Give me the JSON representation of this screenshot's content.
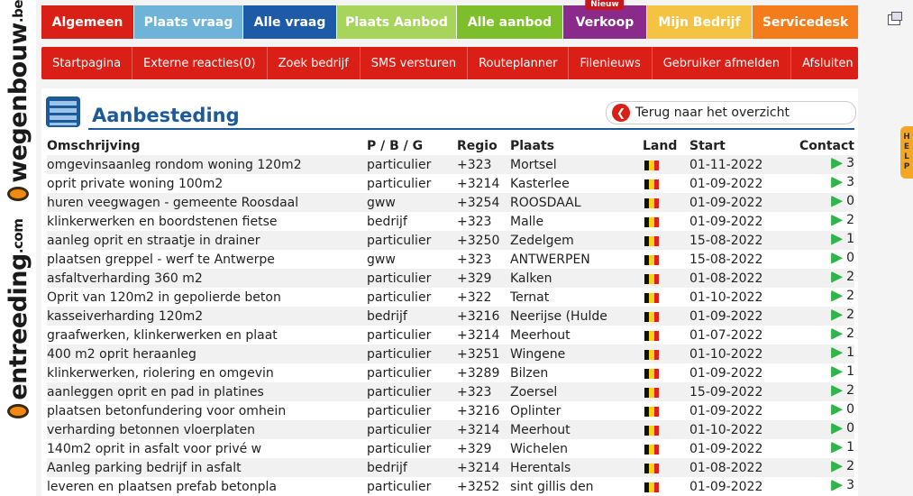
{
  "brand": {
    "text1": "entreeding",
    "text1_suffix": ".com",
    "text2": "wegenbouw",
    "text2_suffix": ".be",
    "accent": "#f28a12"
  },
  "topnav": [
    {
      "label": "Algemeen",
      "color": "#d91f16"
    },
    {
      "label": "Plaats vraag",
      "color": "#6fb3d9"
    },
    {
      "label": "Alle vraag",
      "color": "#1d5aa8"
    },
    {
      "label": "Plaats Aanbod",
      "color": "#a7d45a"
    },
    {
      "label": "Alle aanbod",
      "color": "#7cbf2a"
    },
    {
      "label": "Verkoop",
      "color": "#8a2a8a",
      "badge": "Nieuw"
    },
    {
      "label": "Mijn Bedrijf",
      "color": "#f5c343"
    },
    {
      "label": "Servicedesk",
      "color": "#f57c1a"
    }
  ],
  "subnav": [
    "Startpagina",
    "Externe reacties(0)",
    "Zoek bedrijf",
    "SMS versturen",
    "Routeplanner",
    "Filenieuws",
    "Gebruiker afmelden",
    "Afsluiten"
  ],
  "help": "HELP",
  "page": {
    "title": "Aanbesteding",
    "back_label": "Terug naar het overzicht"
  },
  "table": {
    "headers": [
      "Omschrijving",
      "P / B / G",
      "Regio",
      "Plaats",
      "Land",
      "Start",
      "Contact"
    ],
    "rows": [
      {
        "omschrijving": "omgevinsaanleg rondom woning 120m2",
        "pbg": "particulier",
        "regio": "+323",
        "plaats": "Mortsel",
        "start": "01-11-2022",
        "contact": "3"
      },
      {
        "omschrijving": "oprit private woning 100m2",
        "pbg": "particulier",
        "regio": "+3214",
        "plaats": "Kasterlee",
        "start": "01-09-2022",
        "contact": "3"
      },
      {
        "omschrijving": "huren veegwagen - gemeente Roosdaal",
        "pbg": "gww",
        "regio": "+3254",
        "plaats": "ROOSDAAL",
        "start": "01-09-2022",
        "contact": "0"
      },
      {
        "omschrijving": "klinkerwerken en boordstenen fietse",
        "pbg": "bedrijf",
        "regio": "+323",
        "plaats": "Malle",
        "start": "01-09-2022",
        "contact": "2"
      },
      {
        "omschrijving": "aanleg oprit en straatje in drainer",
        "pbg": "particulier",
        "regio": "+3250",
        "plaats": "Zedelgem",
        "start": "15-08-2022",
        "contact": "1"
      },
      {
        "omschrijving": "plaatsen greppel - werf te Antwerpe",
        "pbg": "gww",
        "regio": "+323",
        "plaats": "ANTWERPEN",
        "start": "15-08-2022",
        "contact": "0"
      },
      {
        "omschrijving": "asfaltverharding 360 m2",
        "pbg": "particulier",
        "regio": "+329",
        "plaats": "Kalken",
        "start": "01-08-2022",
        "contact": "2"
      },
      {
        "omschrijving": "Oprit van 120m2 in gepolierde beton",
        "pbg": "particulier",
        "regio": "+322",
        "plaats": "Ternat",
        "start": "01-10-2022",
        "contact": "2"
      },
      {
        "omschrijving": "kasseiverharding 120m2",
        "pbg": "bedrijf",
        "regio": "+3216",
        "plaats": "Neerijse (Hulde",
        "start": "01-09-2022",
        "contact": "2"
      },
      {
        "omschrijving": "graafwerken, klinkerwerken en plaat",
        "pbg": "particulier",
        "regio": "+3214",
        "plaats": "Meerhout",
        "start": "01-07-2022",
        "contact": "2"
      },
      {
        "omschrijving": "400 m2 oprit heraanleg",
        "pbg": "particulier",
        "regio": "+3251",
        "plaats": "Wingene",
        "start": "01-10-2022",
        "contact": "1"
      },
      {
        "omschrijving": "klinkerwerken, riolering en omgevin",
        "pbg": "particulier",
        "regio": "+3289",
        "plaats": "Bilzen",
        "start": "01-09-2022",
        "contact": "1"
      },
      {
        "omschrijving": "aanleggen oprit en pad in platines",
        "pbg": "particulier",
        "regio": "+323",
        "plaats": "Zoersel",
        "start": "15-09-2022",
        "contact": "2"
      },
      {
        "omschrijving": "plaatsen betonfundering voor omhein",
        "pbg": "particulier",
        "regio": "+3216",
        "plaats": "Oplinter",
        "start": "01-09-2022",
        "contact": "0"
      },
      {
        "omschrijving": "verharding betonnen vloerplaten",
        "pbg": "particulier",
        "regio": "+3214",
        "plaats": "Meerhout",
        "start": "01-10-2022",
        "contact": "0"
      },
      {
        "omschrijving": "140m2 oprit in asfalt voor privé w",
        "pbg": "particulier",
        "regio": "+329",
        "plaats": "Wichelen",
        "start": "01-09-2022",
        "contact": "1"
      },
      {
        "omschrijving": "Aanleg parking bedrijf in asfalt",
        "pbg": "bedrijf",
        "regio": "+3214",
        "plaats": "Herentals",
        "start": "01-08-2022",
        "contact": "2"
      },
      {
        "omschrijving": "leveren en plaatsen prefab betonpla",
        "pbg": "particulier",
        "regio": "+3252",
        "plaats": "sint gillis den",
        "start": "01-09-2022",
        "contact": "3"
      }
    ]
  },
  "icons": {
    "flag": "belgium-flag-icon",
    "contact": "green-arrow-icon",
    "back": "back-arrow-icon"
  }
}
